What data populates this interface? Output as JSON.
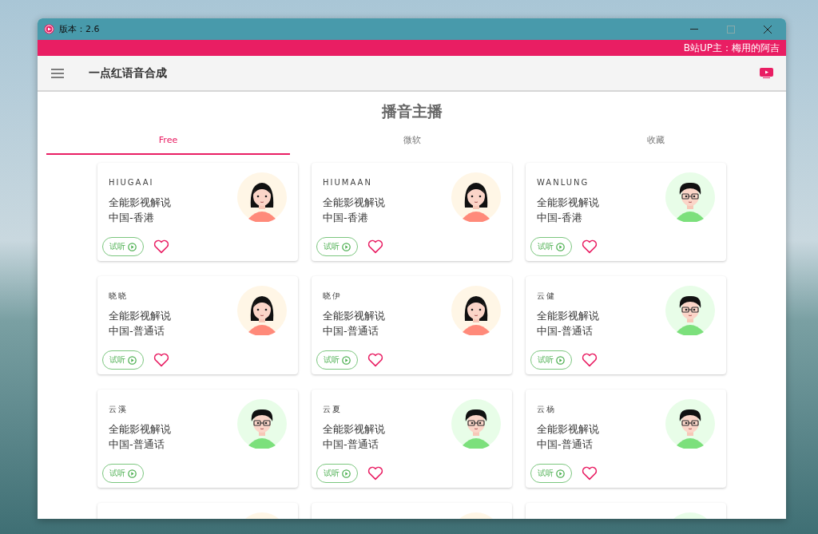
{
  "window": {
    "title": "版本：2.6"
  },
  "banner": {
    "text": "B站UP主：梅用的阿吉"
  },
  "app_bar": {
    "title": "一点红语音合成"
  },
  "heading": "播音主播",
  "tabs": [
    {
      "label": "Free",
      "selected": true
    },
    {
      "label": "微软",
      "selected": false
    },
    {
      "label": "收藏",
      "selected": false
    }
  ],
  "voices": [
    {
      "name": "HIUGAAI",
      "style": "全能影视解说",
      "region": "中国-香港",
      "kind": "female",
      "preview": "试听",
      "has_favorite": true
    },
    {
      "name": "HIUMAAN",
      "style": "全能影视解说",
      "region": "中国-香港",
      "kind": "female",
      "preview": "试听",
      "has_favorite": true
    },
    {
      "name": "WANLUNG",
      "style": "全能影视解说",
      "region": "中国-香港",
      "kind": "male",
      "preview": "试听",
      "has_favorite": true
    },
    {
      "name": "晓晓",
      "style": "全能影视解说",
      "region": "中国-普通话",
      "kind": "female",
      "preview": "试听",
      "has_favorite": true
    },
    {
      "name": "晓伊",
      "style": "全能影视解说",
      "region": "中国-普通话",
      "kind": "female",
      "preview": "试听",
      "has_favorite": true
    },
    {
      "name": "云健",
      "style": "全能影视解说",
      "region": "中国-普通话",
      "kind": "male",
      "preview": "试听",
      "has_favorite": true
    },
    {
      "name": "云溪",
      "style": "全能影视解说",
      "region": "中国-普通话",
      "kind": "male",
      "preview": "试听",
      "has_favorite": false
    },
    {
      "name": "云夏",
      "style": "全能影视解说",
      "region": "中国-普通话",
      "kind": "male",
      "preview": "试听",
      "has_favorite": true
    },
    {
      "name": "云杨",
      "style": "全能影视解说",
      "region": "中国-普通话",
      "kind": "male",
      "preview": "试听",
      "has_favorite": true
    }
  ],
  "partial_voices": [
    {
      "kind": "female"
    },
    {
      "kind": "female"
    },
    {
      "kind": "male"
    }
  ]
}
